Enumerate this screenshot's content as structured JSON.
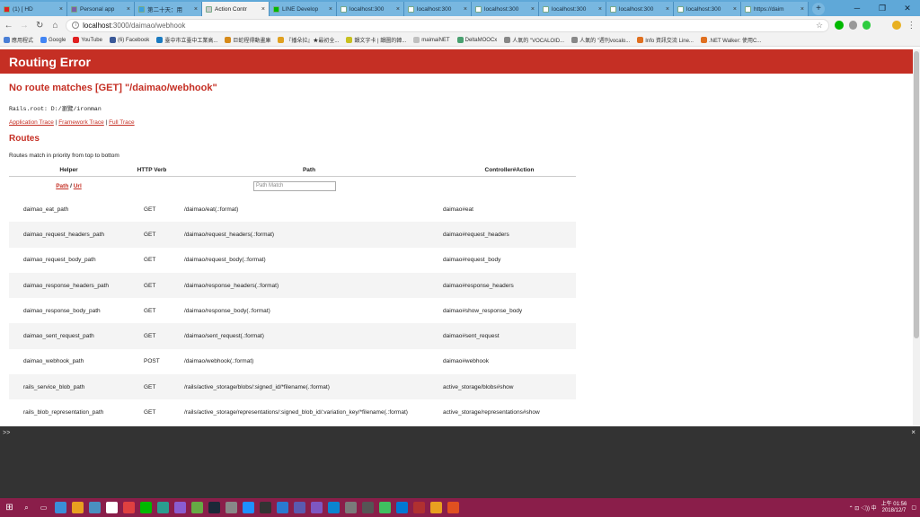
{
  "browser": {
    "tabs": [
      {
        "title": "(1) [ HD",
        "color": "#e02020"
      },
      {
        "title": "Personal app",
        "color": "#7b5ea7"
      },
      {
        "title": "第二十天：用",
        "color": "#3aa0e0"
      },
      {
        "title": "Action Contr",
        "color": "#cccccc",
        "active": true
      },
      {
        "title": "LINE Develop",
        "color": "#00b900"
      },
      {
        "title": "localhost:300",
        "color": "#ffffff"
      },
      {
        "title": "localhost:300",
        "color": "#ffffff"
      },
      {
        "title": "localhost:300",
        "color": "#ffffff"
      },
      {
        "title": "localhost:300",
        "color": "#ffffff"
      },
      {
        "title": "localhost:300",
        "color": "#ffffff"
      },
      {
        "title": "localhost:300",
        "color": "#ffffff"
      },
      {
        "title": "https://daim",
        "color": "#ffffff"
      }
    ],
    "url_host": "localhost",
    "url_path": ":3000/daimao/webhook",
    "bookmarks": [
      {
        "label": "應用程式",
        "color": "#4a7fd6"
      },
      {
        "label": "Google",
        "color": "#4285f4"
      },
      {
        "label": "YouTube",
        "color": "#e02020"
      },
      {
        "label": "(6) Facebook",
        "color": "#3b5998"
      },
      {
        "label": "臺中市立臺中工業高...",
        "color": "#1a7ac0"
      },
      {
        "label": "巨蛇程得動畫庫",
        "color": "#d68a1a"
      },
      {
        "label": "『播朵拉』★最初全...",
        "color": "#e0a020"
      },
      {
        "label": "韻文字卡 | 韻圖的韓...",
        "color": "#c8c020"
      },
      {
        "label": "maimaiNET",
        "color": "#c0c0c0"
      },
      {
        "label": "DeltaMOOCx",
        "color": "#4aa070"
      },
      {
        "label": "人氣的 \"VOCALOID...",
        "color": "#888888"
      },
      {
        "label": "人氣的 \"週刊vocalo...",
        "color": "#888888"
      },
      {
        "label": "Info 資訊交流 Line...",
        "color": "#e07020"
      },
      {
        "label": ".NET Walker: 使用C...",
        "color": "#e07020"
      }
    ]
  },
  "page": {
    "header": "Routing Error",
    "error_title": "No route matches [GET] \"/daimao/webhook\"",
    "rails_root": "Rails.root: D:/瀏覽/ironman",
    "traces": {
      "application": "Application Trace",
      "framework": "Framework Trace",
      "full": "Full Trace",
      "sep": " | "
    },
    "routes_title": "Routes",
    "routes_desc": "Routes match in priority from top to bottom",
    "columns": {
      "helper": "Helper",
      "verb": "HTTP Verb",
      "path": "Path",
      "action": "Controller#Action"
    },
    "filter": {
      "path_label": "Path",
      "slash": " / ",
      "url_label": "Url",
      "placeholder": "Path Match"
    },
    "routes": [
      {
        "helper": "daimao_eat_path",
        "verb": "GET",
        "path": "/daimao/eat(.:format)",
        "action": "daimao#eat"
      },
      {
        "helper": "daimao_request_headers_path",
        "verb": "GET",
        "path": "/daimao/request_headers(.:format)",
        "action": "daimao#request_headers"
      },
      {
        "helper": "daimao_request_body_path",
        "verb": "GET",
        "path": "/daimao/request_body(.:format)",
        "action": "daimao#request_body"
      },
      {
        "helper": "daimao_response_headers_path",
        "verb": "GET",
        "path": "/daimao/response_headers(.:format)",
        "action": "daimao#response_headers"
      },
      {
        "helper": "daimao_response_body_path",
        "verb": "GET",
        "path": "/daimao/response_body(.:format)",
        "action": "daimao#show_response_body"
      },
      {
        "helper": "daimao_sent_request_path",
        "verb": "GET",
        "path": "/daimao/sent_request(.:format)",
        "action": "daimao#sent_request"
      },
      {
        "helper": "daimao_webhook_path",
        "verb": "POST",
        "path": "/daimao/webhook(.:format)",
        "action": "daimao#webhook"
      },
      {
        "helper": "rails_service_blob_path",
        "verb": "GET",
        "path": "/rails/active_storage/blobs/:signed_id/*filename(.:format)",
        "action": "active_storage/blobs#show"
      },
      {
        "helper": "rails_blob_representation_path",
        "verb": "GET",
        "path": "/rails/active_storage/representations/:signed_blob_id/:variation_key/*filename(.:format)",
        "action": "active_storage/representations#show"
      }
    ]
  },
  "console": {
    "prompt": ">>",
    "close": "×"
  },
  "taskbar": {
    "time": "上午 01:56",
    "date": "2018/12/7",
    "icons": [
      "#3a8fd8",
      "#e8a020",
      "#4a90c0",
      "#ffffff",
      "#e04040",
      "#00b900",
      "#2a9d8f",
      "#8a5cd0",
      "#66aa44",
      "#1b2838",
      "#888888",
      "#1e90ff",
      "#333333",
      "#2a7ad0",
      "#5a5ab0",
      "#7e57c2",
      "#0a84d0",
      "#7a7a7a",
      "#555555",
      "#40c060",
      "#0078d4",
      "#b03030",
      "#e8a020",
      "#e05020"
    ]
  }
}
